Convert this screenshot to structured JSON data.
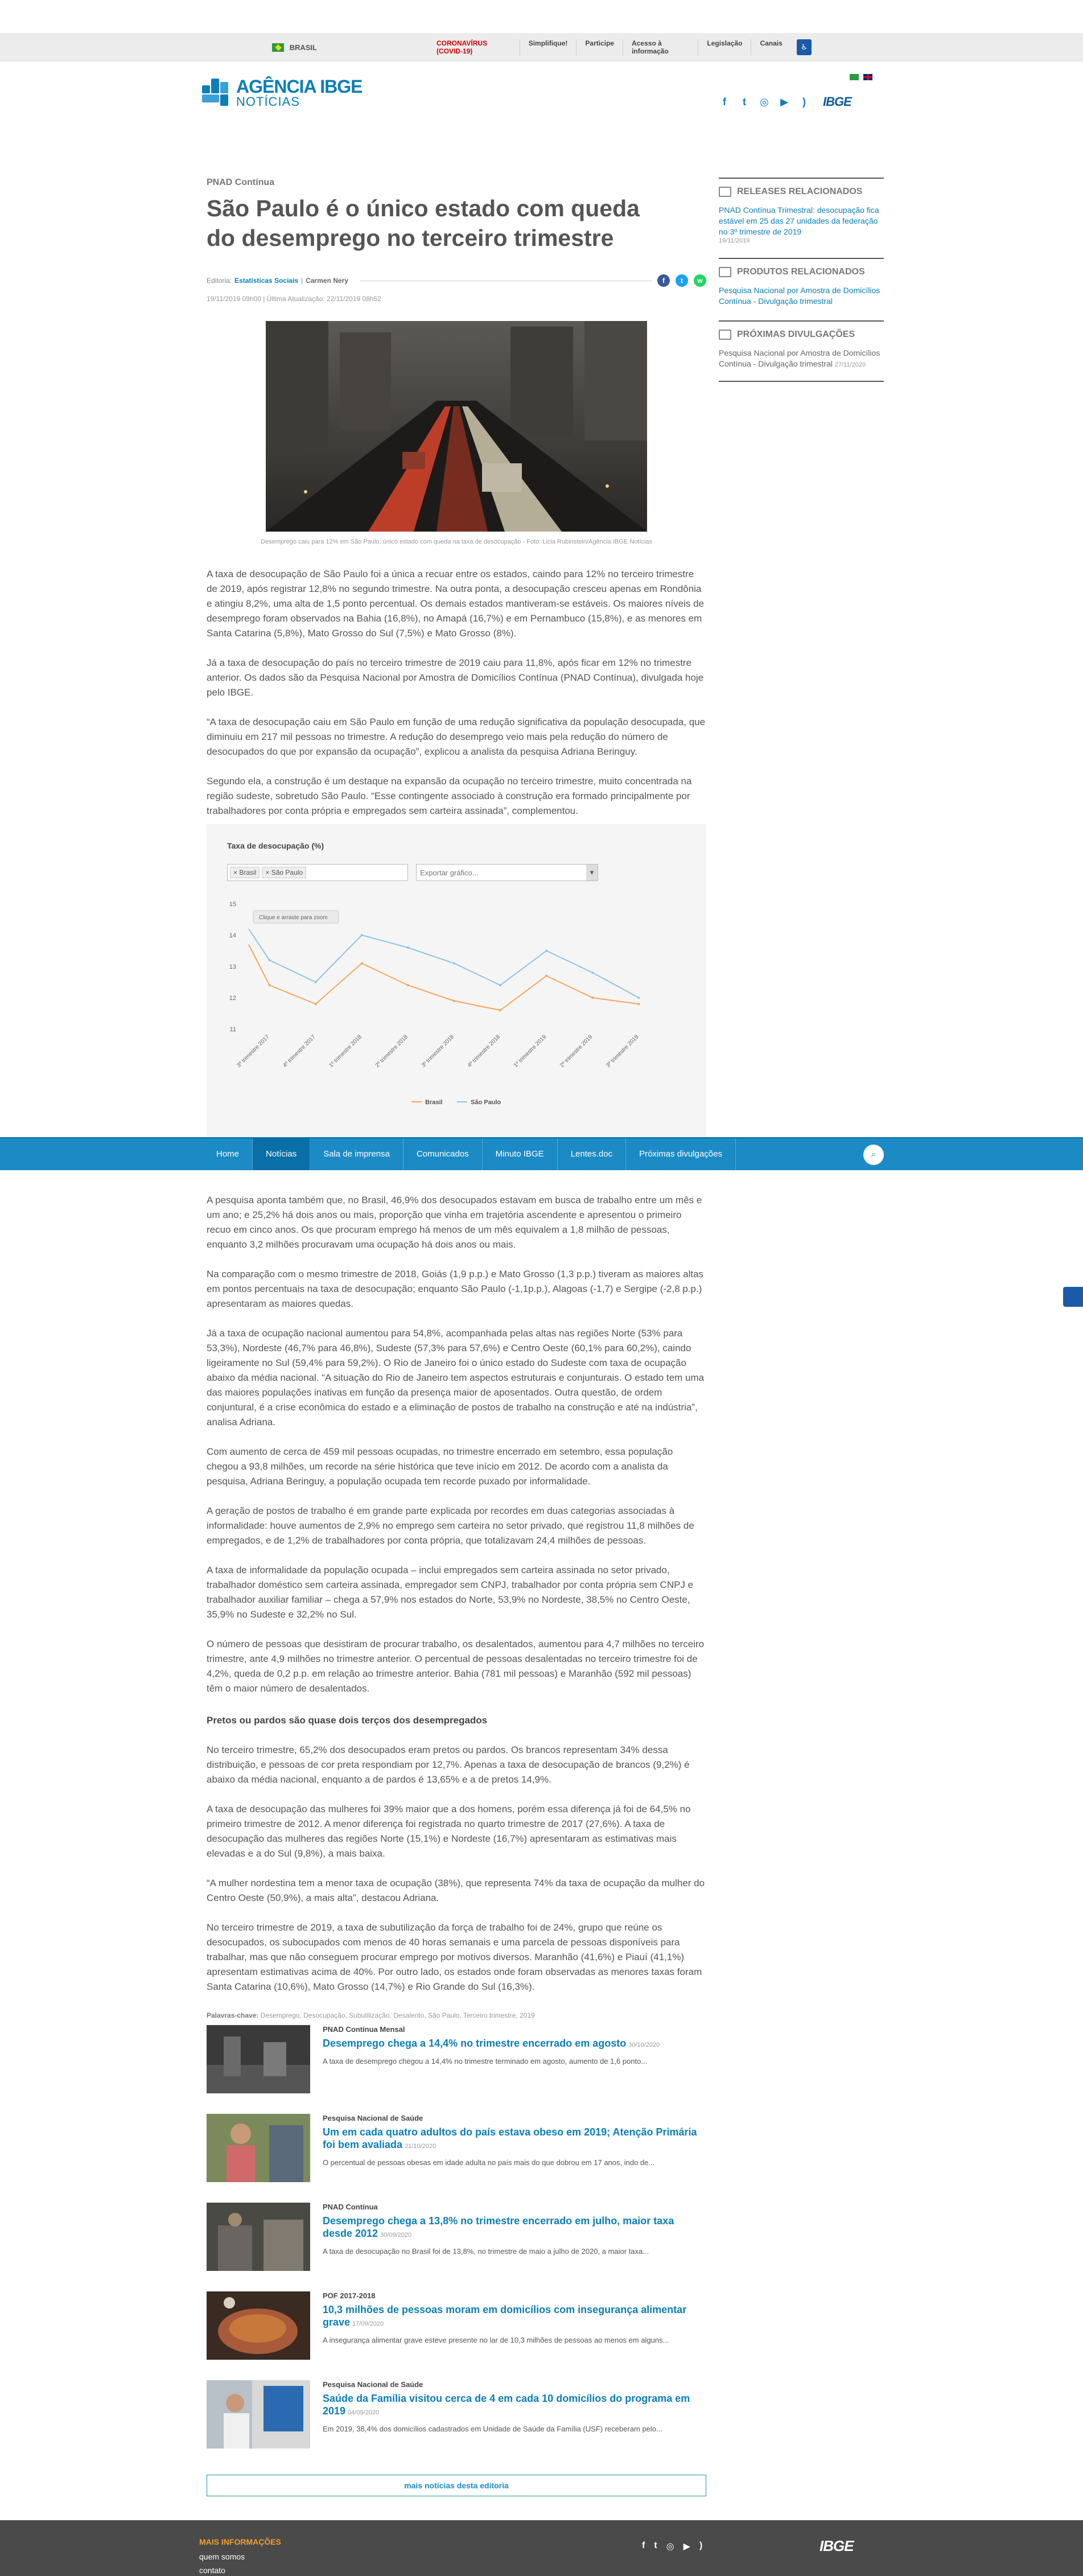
{
  "govbar": {
    "brasil": "BRASIL",
    "links": [
      "CORONAVÍRUS (COVID-19)",
      "Simplifique!",
      "Participe",
      "Acesso à informação",
      "Legislação",
      "Canais"
    ]
  },
  "header": {
    "logo_line1": "AGÊNCIA IBGE",
    "logo_line2": "NOTÍCIAS",
    "brand": "IBGE"
  },
  "article": {
    "section": "PNAD Contínua",
    "title": "São Paulo é o único estado com queda do desemprego no terceiro trimestre",
    "editoria_label": "Editoria:",
    "editoria": "Estatísticas Sociais",
    "reporter": "Carmen Nery",
    "dates": "19/11/2019 09h00 | Última Atualização: 22/11/2019 08h52",
    "caption": "Desemprego caiu para 12% em São Paulo, único estado com queda na taxa de desocupação - Foto: Licia Rubinstein/Agência IBGE Notícias",
    "paragraphs": [
      "A taxa de desocupação de São Paulo foi a única a recuar entre os estados, caindo para 12% no terceiro trimestre de 2019, após registrar 12,8% no segundo trimestre. Na outra ponta, a desocupação cresceu apenas em Rondônia e atingiu 8,2%, uma alta de 1,5 ponto percentual. Os demais estados mantiveram-se estáveis. Os maiores níveis de desemprego foram observados na Bahia (16,8%), no Amapá (16,7%) e em Pernambuco (15,8%), e as menores em Santa Catarina (5,8%), Mato Grosso do Sul (7,5%) e Mato Grosso (8%).",
      "Já a taxa de desocupação do país no terceiro trimestre de 2019 caiu para 11,8%, após ficar em 12% no trimestre anterior. Os dados são da Pesquisa Nacional por Amostra de Domicílios Contínua (PNAD Contínua), divulgada hoje pelo IBGE.",
      "“A taxa de desocupação caiu em São Paulo em função de uma redução significativa da população desocupada, que diminuiu em 217 mil pessoas no trimestre. A redução do desemprego veio mais pela redução do número de desocupados do que por expansão da ocupação”, explicou a analista da pesquisa Adriana Beringuy.",
      "Segundo ela, a construção é um destaque na expansão da ocupação no terceiro trimestre, muito concentrada na região sudeste, sobretudo São Paulo. “Esse contingente associado à construção era formado principalmente por trabalhadores por conta própria e empregados sem carteira assinada”, complementou."
    ],
    "paragraphs2": [
      "A pesquisa aponta também que, no Brasil, 46,9% dos desocupados estavam em busca de trabalho entre um mês e um ano; e 25,2% há dois anos ou mais, proporção que vinha em trajetória ascendente e apresentou o primeiro recuo em cinco anos. Os que procuram emprego há menos de um mês equivalem a 1,8 milhão de pessoas, enquanto 3,2 milhões procuravam uma ocupação há dois anos ou mais.",
      "Na comparação com o mesmo trimestre de 2018, Goiás (1,9 p.p.) e Mato Grosso (1,3 p.p.) tiveram as maiores altas em pontos percentuais na taxa de desocupação; enquanto São Paulo (-1,1p.p.), Alagoas (-1,7) e Sergipe (-2,8 p.p.) apresentaram as maiores quedas.",
      "Já a taxa de ocupação nacional aumentou para 54,8%, acompanhada pelas altas nas regiões Norte (53% para 53,3%), Nordeste (46,7% para 46,8%), Sudeste (57,3% para 57,6%) e Centro Oeste (60,1% para 60,2%), caindo ligeiramente no Sul (59,4% para 59,2%). O Rio de Janeiro foi o único estado do Sudeste com taxa de ocupação abaixo da média nacional. “A situação do Rio de Janeiro tem aspectos estruturais e conjunturais. O estado tem uma das maiores populações inativas em função da presença maior de aposentados. Outra questão, de ordem conjuntural, é a crise econômica do estado e a eliminação de postos de trabalho na construção e até na indústria”, analisa Adriana.",
      "Com aumento de cerca de 459 mil pessoas ocupadas, no trimestre encerrado em setembro, essa população chegou a 93,8 milhões, um recorde na série histórica que teve início em 2012. De acordo com a analista da pesquisa, Adriana Beringuy, a população ocupada tem recorde puxado por informalidade.",
      "A geração de postos de trabalho é em grande parte explicada por recordes em duas categorias associadas à informalidade: houve aumentos de 2,9% no emprego sem carteira no setor privado, que registrou 11,8 milhões de empregados, e de 1,2% de trabalhadores por conta própria, que totalizavam 24,4 milhões de pessoas.",
      "A taxa de informalidade da população ocupada – inclui empregados sem carteira assinada no setor privado, trabalhador doméstico sem carteira assinada, empregador sem CNPJ, trabalhador por conta própria sem CNPJ e trabalhador auxiliar familiar – chega a 57,9% nos estados do Norte, 53,9% no Nordeste, 38,5% no Centro Oeste, 35,9% no Sudeste e 32,2% no Sul.",
      "O número de pessoas que desistiram de procurar trabalho, os desalentados, aumentou para 4,7 milhões no terceiro trimestre, ante 4,9 milhões no trimestre anterior. O percentual de pessoas desalentadas no terceiro trimestre foi de 4,2%, queda de 0,2 p.p. em relação ao trimestre anterior. Bahia (781 mil pessoas) e Maranhão (592 mil pessoas) têm o maior número de desalentados."
    ],
    "subtitle": "Pretos ou pardos são quase dois terços dos desempregados",
    "paragraphs3": [
      "No terceiro trimestre, 65,2% dos desocupados eram pretos ou pardos. Os brancos representam 34% dessa distribuição, e pessoas de cor preta respondiam por 12,7%. Apenas a taxa de desocupação de brancos (9,2%) é abaixo da média nacional, enquanto a de pardos é 13,65% e a de pretos 14,9%.",
      "A taxa de desocupação das mulheres foi 39% maior que a dos homens, porém essa diferença já foi de 64,5% no primeiro trimestre de 2012. A menor diferença foi registrada no quarto trimestre de 2017 (27,6%). A taxa de desocupação das mulheres das regiões Norte (15,1%) e Nordeste (16,7%) apresentaram as estimativas mais elevadas e a do Sul (9,8%), a mais baixa.",
      "“A mulher nordestina tem a menor taxa de ocupação (38%), que representa 74% da taxa de ocupação da mulher do Centro Oeste (50,9%), a mais alta”, destacou Adriana.",
      "No terceiro trimestre de 2019, a taxa de subutilização da força de trabalho foi de 24%, grupo que reúne os desocupados, os subocupados com menos de 40 horas semanais e uma parcela de pessoas disponíveis para trabalhar, mas que não conseguem procurar emprego por motivos diversos. Maranhão (41,6%) e Piauí (41,1%) apresentam estimativas acima de 40%. Por outro lado, os estados onde foram observadas as menores taxas foram Santa Catarina (10,6%), Mato Grosso (14,7%) e Rio Grande do Sul (16,3%)."
    ],
    "keywords_label": "Palavras-chave:",
    "keywords": "Desemprego, Desocupação, Subutilização, Desalento, São Paulo, Terceiro trimestre, 2019"
  },
  "chart": {
    "title": "Taxa de desocupação (%)",
    "tags": [
      "× Brasil",
      "× São Paulo"
    ],
    "export_placeholder": "Exportar gráfico...",
    "tooltip": "Clique e arraste para zoom"
  },
  "chart_data": {
    "type": "line",
    "title": "Taxa de desocupação (%)",
    "x": [
      "3º trimestre 2017",
      "4º trimestre 2017",
      "1º trimestre 2018",
      "2º trimestre 2018",
      "3º trimestre 2018",
      "4º trimestre 2018",
      "1º trimestre 2019",
      "2º trimestre 2019",
      "3º trimestre 2019"
    ],
    "series": [
      {
        "name": "Brasil",
        "values": [
          12.4,
          11.8,
          13.1,
          12.4,
          11.9,
          11.6,
          12.7,
          12.0,
          11.8
        ],
        "color": "#f5a55a"
      },
      {
        "name": "São Paulo",
        "values": [
          13.2,
          12.5,
          14.0,
          13.6,
          13.1,
          12.4,
          13.5,
          12.8,
          12.0
        ],
        "color": "#8cc4e8"
      }
    ],
    "extra_points": {
      "Brasil_start": 13.7,
      "SaoPaulo_start": 14.2
    },
    "ylim": [
      11,
      15
    ],
    "yticks": [
      "11",
      "12",
      "13",
      "14",
      "15"
    ],
    "legend": "bottom",
    "grid": false
  },
  "nav": {
    "items": [
      "Home",
      "Notícias",
      "Sala de imprensa",
      "Comunicados",
      "Minuto IBGE",
      "Lentes.doc",
      "Próximas divulgações"
    ]
  },
  "sidebar": {
    "releases_title": "RELEASES RELACIONADOS",
    "release_item": "PNAD Contínua Trimestral: desocupação fica estável em 25 das 27 unidades da federação no 3º trimestre de 2019",
    "release_date": "19/11/2019",
    "products_title": "PRODUTOS RELACIONADOS",
    "product_item": "Pesquisa Nacional por Amostra de Domicílios Contínua - Divulgação trimestral",
    "next_title": "PRÓXIMAS DIVULGAÇÕES",
    "next_item": "Pesquisa Nacional por Amostra de Domicílios Contínua - Divulgação trimestral",
    "next_date": "27/11/2020"
  },
  "related": [
    {
      "kicker": "PNAD Contínua Mensal",
      "title": "Desemprego chega a 14,4% no trimestre encerrado em agosto",
      "date": "30/10/2020",
      "desc": "A taxa de desemprego chegou a 14,4% no trimestre terminado em agosto, aumento de 1,6 ponto..."
    },
    {
      "kicker": "Pesquisa Nacional de Saúde",
      "title": "Um em cada quatro adultos do país estava obeso em 2019; Atenção Primária foi bem avaliada",
      "date": "21/10/2020",
      "desc": "O percentual de pessoas obesas em idade adulta no país mais do que dobrou em 17 anos, indo de..."
    },
    {
      "kicker": "PNAD Contínua",
      "title": "Desemprego chega a 13,8% no trimestre encerrado em julho, maior taxa desde 2012",
      "date": "30/09/2020",
      "desc": "A taxa de desocupação no Brasil foi de 13,8%, no trimestre de maio a julho de 2020, a maior taxa..."
    },
    {
      "kicker": "POF 2017-2018",
      "title": "10,3 milhões de pessoas moram em domicílios com insegurança alimentar grave",
      "date": "17/09/2020",
      "desc": "A insegurança alimentar grave esteve presente no lar de 10,3 milhões de pessoas ao menos em alguns..."
    },
    {
      "kicker": "Pesquisa Nacional de Saúde",
      "title": "Saúde da Família visitou cerca de 4 em cada 10 domicílios do programa em 2019",
      "date": "04/09/2020",
      "desc": "Em 2019, 38,4% dos domicílios cadastrados em Unidade de Saúde da Família (USF) receberam pelo..."
    }
  ],
  "more_button": "mais notícias desta editoria",
  "footer": {
    "title": "MAIS INFORMAÇÕES",
    "links": [
      "quem somos",
      "contato"
    ],
    "brand": "IBGE"
  }
}
